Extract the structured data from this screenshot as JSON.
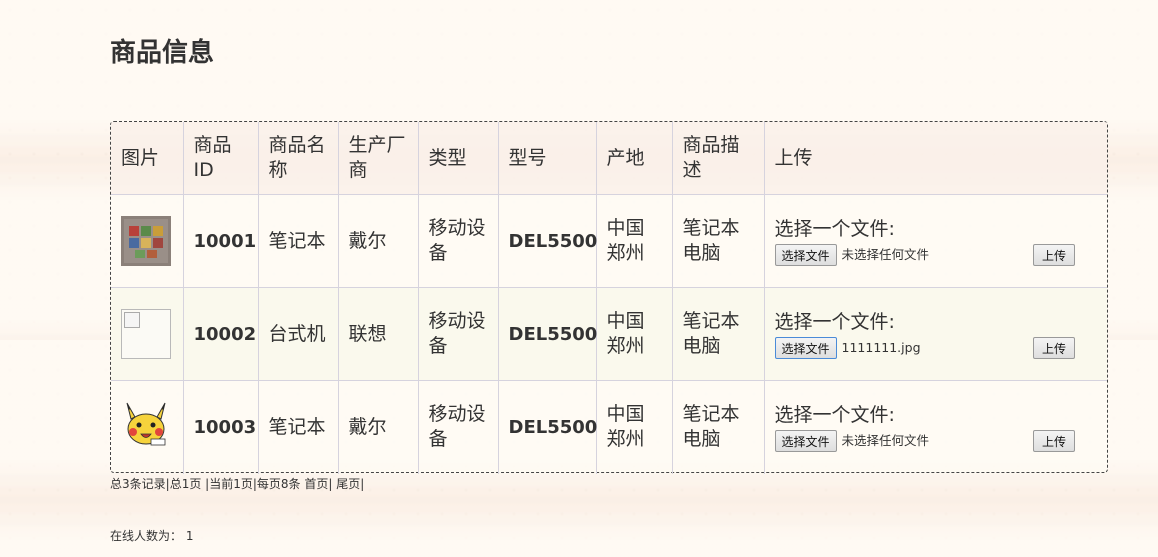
{
  "page": {
    "title": "商品信息"
  },
  "table": {
    "headers": [
      "图片",
      "商品ID",
      "商品名称",
      "生产厂商",
      "类型",
      "型号",
      "产地",
      "商品描述",
      "上传"
    ],
    "rows": [
      {
        "id": "10001",
        "name": "笔记本",
        "maker": "戴尔",
        "type": "移动设备",
        "model": "DEL5500",
        "origin": "中国郑州",
        "desc": "笔记本电脑",
        "upload_label": "选择一个文件:",
        "file_button": "选择文件",
        "file_name": "未选择任何文件",
        "submit": "上传",
        "image": "pixel-mosaic-thumbnail"
      },
      {
        "id": "10002",
        "name": "台式机",
        "maker": "联想",
        "type": "移动设备",
        "model": "DEL5500",
        "origin": "中国郑州",
        "desc": "笔记本电脑",
        "upload_label": "选择一个文件:",
        "file_button": "选择文件",
        "file_name": "1111111.jpg",
        "submit": "上传",
        "image": "broken-image-icon"
      },
      {
        "id": "10003",
        "name": "笔记本",
        "maker": "戴尔",
        "type": "移动设备",
        "model": "DEL5500",
        "origin": "中国郑州",
        "desc": "笔记本电脑",
        "upload_label": "选择一个文件:",
        "file_button": "选择文件",
        "file_name": "未选择任何文件",
        "submit": "上传",
        "image": "pikachu-thumbnail"
      }
    ]
  },
  "pager": {
    "total_records": "总3条记录",
    "total_pages": "总1页",
    "current_page": "当前1页",
    "per_page": "每页8条",
    "first": "首页",
    "last": "尾页"
  },
  "online": {
    "text": "在线人数为：  1"
  },
  "colors": {
    "border": "#d6d3de",
    "text": "#333333",
    "alt_row": "#faf8ec",
    "focus": "#4a8bd8"
  }
}
